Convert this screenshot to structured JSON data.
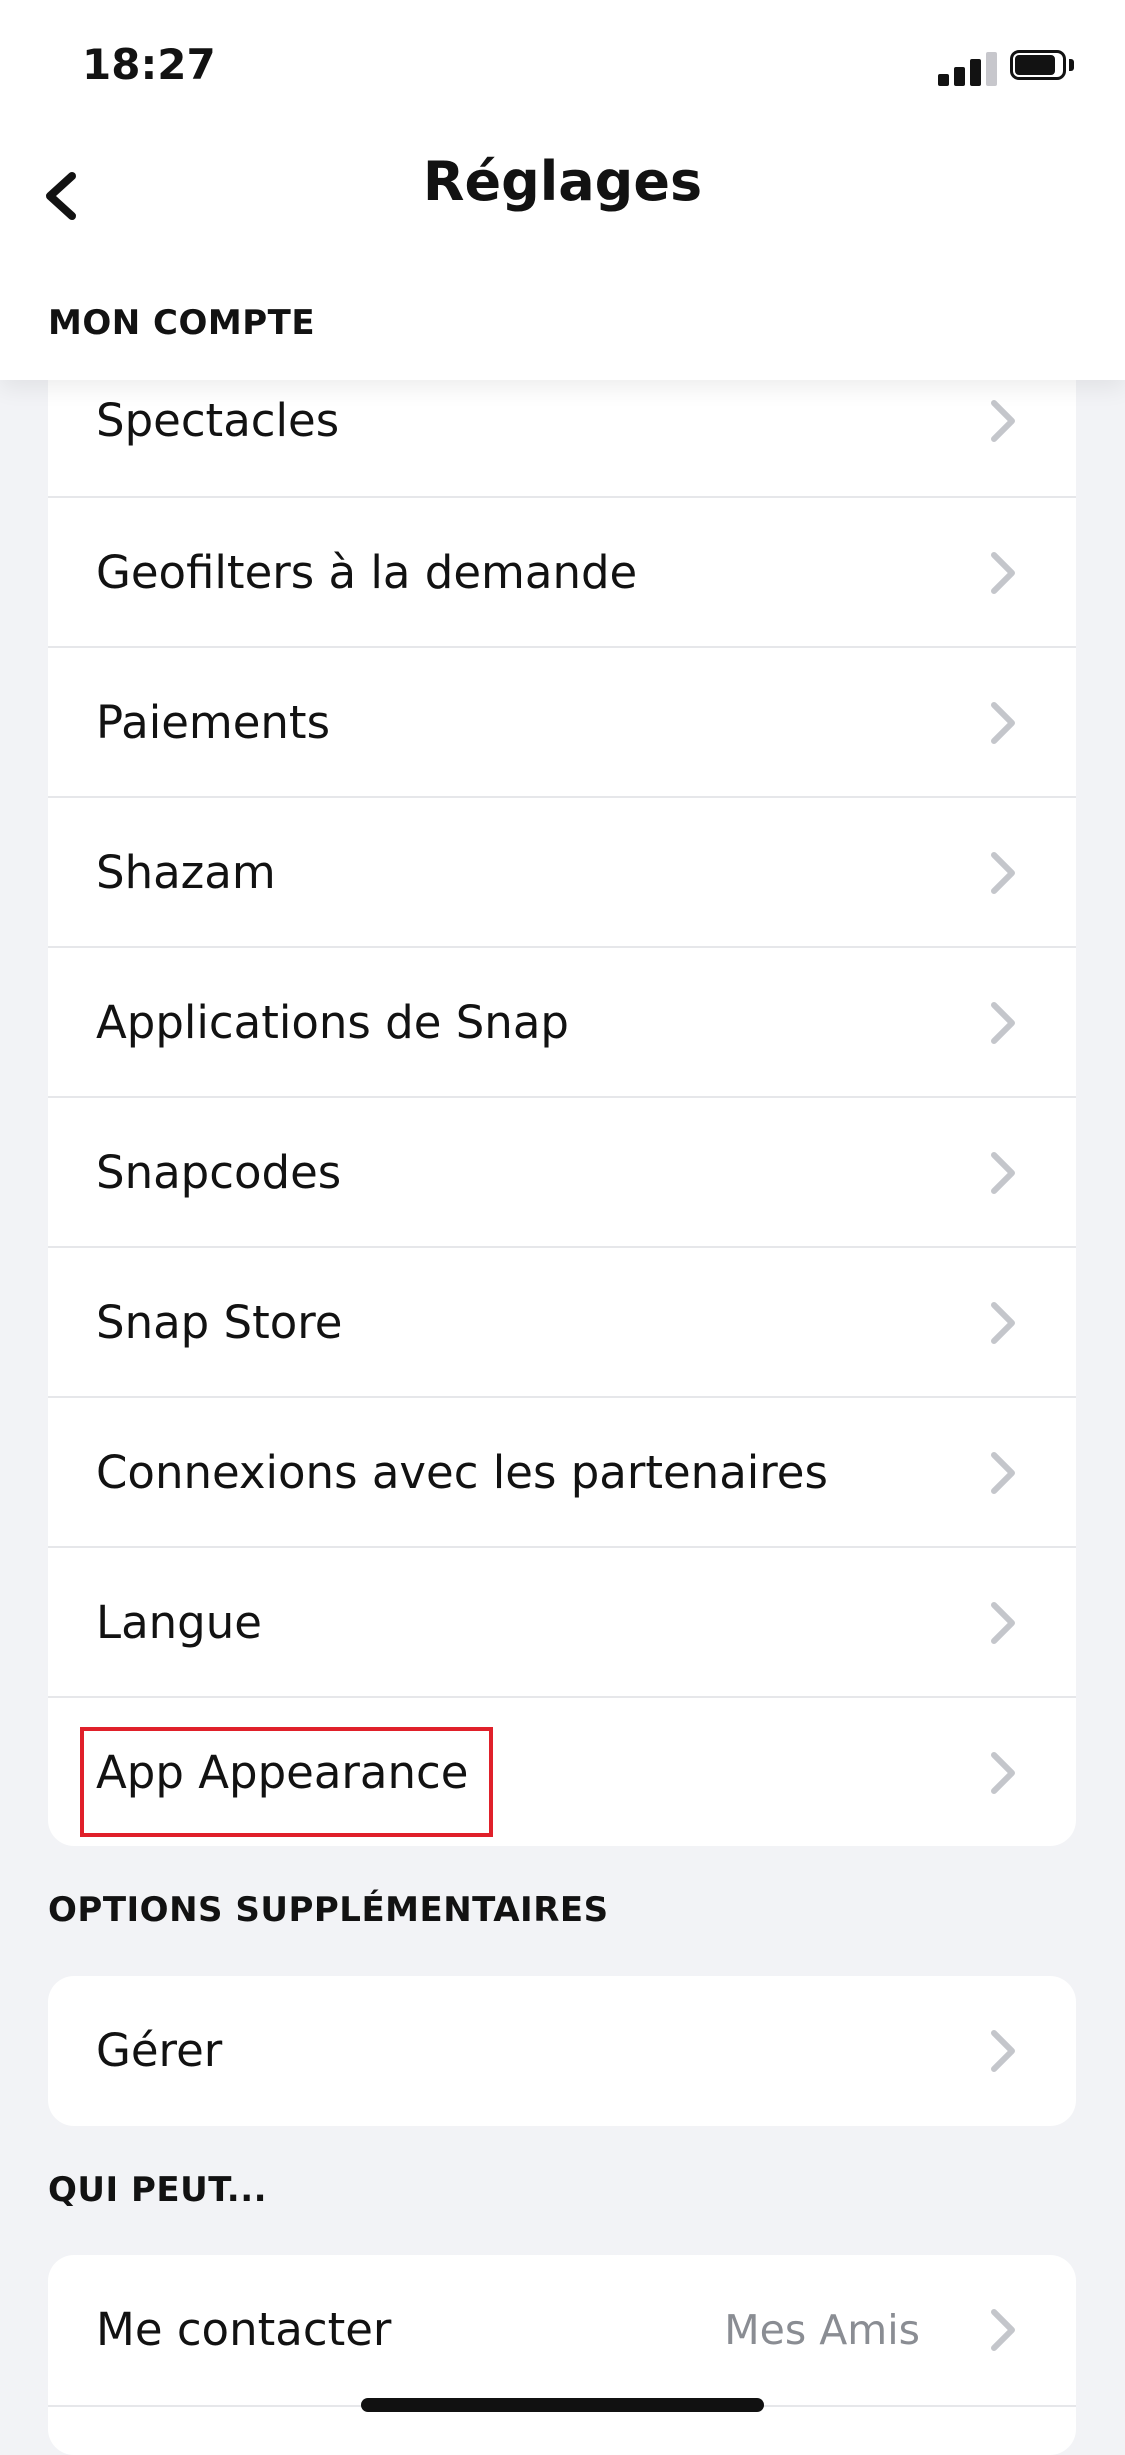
{
  "status_bar": {
    "time": "18:27"
  },
  "header": {
    "title": "Réglages",
    "back_icon": "chevron-left-icon"
  },
  "sections": {
    "mon_compte": {
      "title": "MON COMPTE",
      "items": [
        {
          "label": "Spectacles"
        },
        {
          "label": "Geofilters à la demande"
        },
        {
          "label": "Paiements"
        },
        {
          "label": "Shazam"
        },
        {
          "label": "Applications de Snap"
        },
        {
          "label": "Snapcodes"
        },
        {
          "label": "Snap Store"
        },
        {
          "label": "Connexions avec les partenaires"
        },
        {
          "label": "Langue"
        },
        {
          "label": "App Appearance"
        }
      ]
    },
    "options": {
      "title": "OPTIONS SUPPLÉMENTAIRES",
      "items": [
        {
          "label": "Gérer"
        }
      ]
    },
    "qui_peut": {
      "title": "QUI PEUT...",
      "items": [
        {
          "label": "Me contacter",
          "value": "Mes Amis"
        }
      ]
    }
  },
  "colors": {
    "highlight": "#e0202a",
    "background": "#f2f3f6",
    "chevron": "#c4c6cb"
  }
}
